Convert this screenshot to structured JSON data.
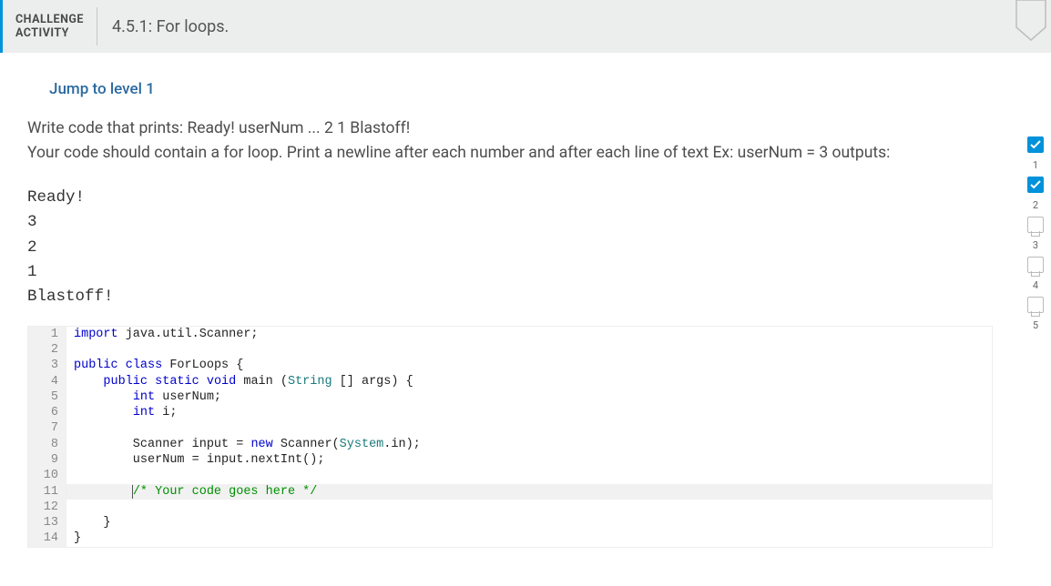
{
  "header": {
    "label_line1": "CHALLENGE",
    "label_line2": "ACTIVITY",
    "title": "4.5.1: For loops."
  },
  "jump_link_label": "Jump to level 1",
  "prompt": {
    "line1": "Write code that prints: Ready! userNum ... 2 1 Blastoff!",
    "line2": "Your code should contain a for loop. Print a newline after each number and after each line of text Ex: userNum = 3 outputs:"
  },
  "sample_output_lines": [
    "Ready!",
    "3",
    "2",
    "1",
    "Blastoff!"
  ],
  "code_lines": [
    {
      "n": 1,
      "hl": false,
      "segs": [
        {
          "c": "kw",
          "t": "import"
        },
        {
          "t": " java.util.Scanner;"
        }
      ]
    },
    {
      "n": 2,
      "hl": false,
      "segs": []
    },
    {
      "n": 3,
      "hl": false,
      "segs": [
        {
          "c": "kw",
          "t": "public"
        },
        {
          "t": " "
        },
        {
          "c": "kw",
          "t": "class"
        },
        {
          "t": " ForLoops {"
        }
      ]
    },
    {
      "n": 4,
      "hl": false,
      "segs": [
        {
          "t": "    "
        },
        {
          "c": "kw",
          "t": "public"
        },
        {
          "t": " "
        },
        {
          "c": "kw",
          "t": "static"
        },
        {
          "t": " "
        },
        {
          "c": "kw",
          "t": "void"
        },
        {
          "t": " main ("
        },
        {
          "c": "type",
          "t": "String"
        },
        {
          "t": " [] args) {"
        }
      ]
    },
    {
      "n": 5,
      "hl": false,
      "segs": [
        {
          "t": "        "
        },
        {
          "c": "kw",
          "t": "int"
        },
        {
          "t": " userNum;"
        }
      ]
    },
    {
      "n": 6,
      "hl": false,
      "segs": [
        {
          "t": "        "
        },
        {
          "c": "kw",
          "t": "int"
        },
        {
          "t": " i;"
        }
      ]
    },
    {
      "n": 7,
      "hl": false,
      "segs": []
    },
    {
      "n": 8,
      "hl": false,
      "segs": [
        {
          "t": "        Scanner input = "
        },
        {
          "c": "kw",
          "t": "new"
        },
        {
          "t": " Scanner("
        },
        {
          "c": "type",
          "t": "System"
        },
        {
          "t": ".in);"
        }
      ]
    },
    {
      "n": 9,
      "hl": false,
      "segs": [
        {
          "t": "        userNum = input.nextInt();"
        }
      ]
    },
    {
      "n": 10,
      "hl": false,
      "segs": []
    },
    {
      "n": 11,
      "hl": true,
      "segs": [
        {
          "t": "        "
        },
        {
          "c": "cm",
          "cursor": true,
          "t": "/* Your code goes here */"
        }
      ]
    },
    {
      "n": 12,
      "hl": false,
      "segs": []
    },
    {
      "n": 13,
      "hl": false,
      "segs": [
        {
          "t": "    }"
        }
      ]
    },
    {
      "n": 14,
      "hl": false,
      "segs": [
        {
          "t": "}"
        }
      ]
    }
  ],
  "steps": [
    {
      "num": "1",
      "state": "done"
    },
    {
      "num": "2",
      "state": "done"
    },
    {
      "num": "3",
      "state": "pending"
    },
    {
      "num": "4",
      "state": "pending"
    },
    {
      "num": "5",
      "state": "pending"
    }
  ]
}
